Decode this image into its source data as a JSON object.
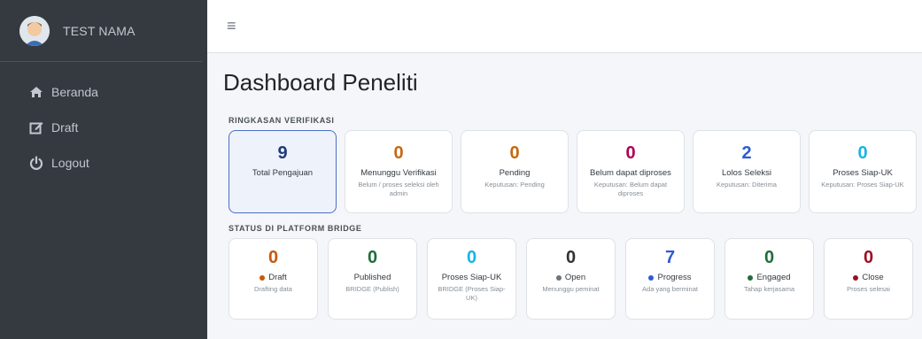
{
  "user": {
    "name": "TEST NAMA",
    "avatar_icon": "user-avatar-icon"
  },
  "sidebar": {
    "items": [
      {
        "label": "Beranda",
        "icon": "home-icon"
      },
      {
        "label": "Draft",
        "icon": "edit-icon"
      },
      {
        "label": "Logout",
        "icon": "power-icon"
      }
    ]
  },
  "topbar": {
    "menu_icon": "≡"
  },
  "page": {
    "title": "Dashboard Peneliti"
  },
  "verification": {
    "section_label": "RINGKASAN VERIFIKASI",
    "cards": [
      {
        "value": "9",
        "label": "Total Pengajuan",
        "sub": "",
        "color": "#1e3a7a"
      },
      {
        "value": "0",
        "label": "Menunggu Verifikasi",
        "sub": "Belum / proses seleksi oleh admin",
        "color": "#c7680c"
      },
      {
        "value": "0",
        "label": "Pending",
        "sub": "Keputusan: Pending",
        "color": "#c7680c"
      },
      {
        "value": "0",
        "label": "Belum dapat diproses",
        "sub": "Keputusan: Belum dapat diproses",
        "color": "#b00055"
      },
      {
        "value": "2",
        "label": "Lolos Seleksi",
        "sub": "Keputusan: Diterima",
        "color": "#2f5bd2"
      },
      {
        "value": "0",
        "label": "Proses Siap-UK",
        "sub": "Keputusan: Proses Siap-UK",
        "color": "#17b4e6"
      }
    ]
  },
  "bridge": {
    "section_label": "STATUS DI PLATFORM BRIDGE",
    "cards": [
      {
        "value": "0",
        "label": "Draft",
        "sub": "Drafting data",
        "color": "#c7580c",
        "dot": "#c7580c"
      },
      {
        "value": "0",
        "label": "Published",
        "sub": "BRIDGE (Publish)",
        "color": "#1f6e3a",
        "dot": ""
      },
      {
        "value": "0",
        "label": "Proses Siap-UK",
        "sub": "BRIDGE (Proses Siap-UK)",
        "color": "#17b4e6",
        "dot": ""
      },
      {
        "value": "0",
        "label": "Open",
        "sub": "Menunggu peminat",
        "color": "#333333",
        "dot": "#6c757d"
      },
      {
        "value": "7",
        "label": "Progress",
        "sub": "Ada yang berminat",
        "color": "#2f5bd2",
        "dot": "#2f5bd2"
      },
      {
        "value": "0",
        "label": "Engaged",
        "sub": "Tahap kerjasama",
        "color": "#1f6e3a",
        "dot": "#1f6e3a"
      },
      {
        "value": "0",
        "label": "Close",
        "sub": "Proses selesai",
        "color": "#9b1022",
        "dot": "#9b1022"
      }
    ]
  }
}
